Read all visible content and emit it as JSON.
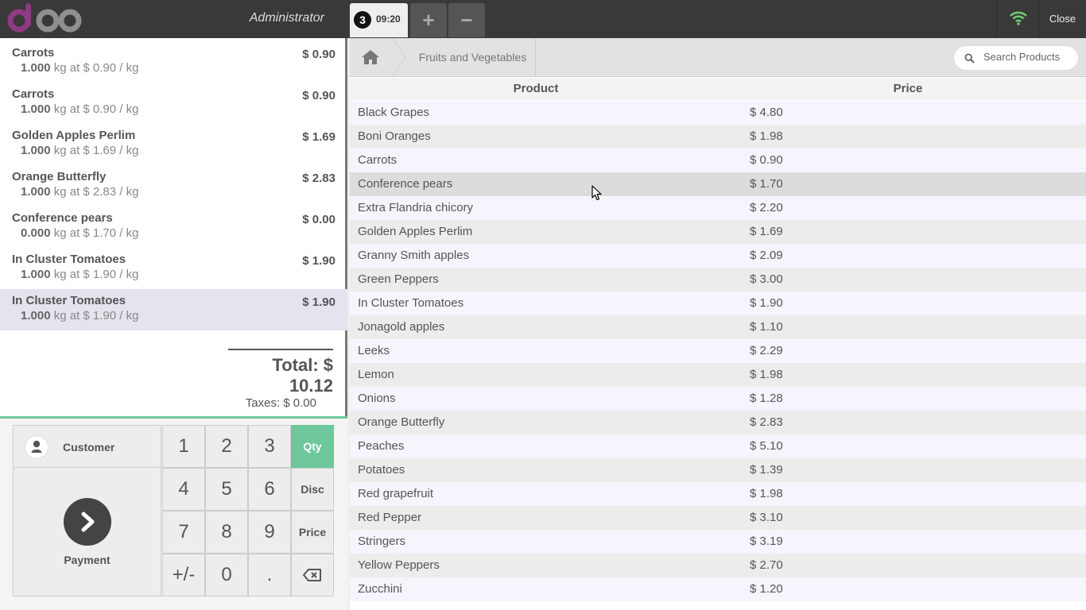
{
  "header": {
    "cashier": "Administrator",
    "order_tab": {
      "sequence": "3",
      "time": "09:20"
    },
    "add_order_label": "+",
    "remove_order_label": "−",
    "close_label": "Close",
    "wifi_status_color": "#6ec86e"
  },
  "orderlines": [
    {
      "name": "Carrots",
      "price": "$ 0.90",
      "qty": "1.000",
      "info": " kg at $ 0.90 / kg"
    },
    {
      "name": "Carrots",
      "price": "$ 0.90",
      "qty": "1.000",
      "info": " kg at $ 0.90 / kg"
    },
    {
      "name": "Golden Apples Perlim",
      "price": "$ 1.69",
      "qty": "1.000",
      "info": " kg at $ 1.69 / kg"
    },
    {
      "name": "Orange Butterfly",
      "price": "$ 2.83",
      "qty": "1.000",
      "info": " kg at $ 2.83 / kg"
    },
    {
      "name": "Conference pears",
      "price": "$ 0.00",
      "qty": "0.000",
      "info": " kg at $ 1.70 / kg"
    },
    {
      "name": "In Cluster Tomatoes",
      "price": "$ 1.90",
      "qty": "1.000",
      "info": " kg at $ 1.90 / kg"
    },
    {
      "name": "In Cluster Tomatoes",
      "price": "$ 1.90",
      "qty": "1.000",
      "info": " kg at $ 1.90 / kg"
    }
  ],
  "summary": {
    "total": "Total: $ 10.12",
    "taxes": "Taxes: $ 0.00"
  },
  "actionpad": {
    "customer_label": "Customer",
    "payment_label": "Payment"
  },
  "numpad": {
    "keys": [
      "1",
      "2",
      "3",
      "4",
      "5",
      "6",
      "7",
      "8",
      "9",
      "+/-",
      "0",
      "."
    ],
    "modes": [
      "Qty",
      "Disc",
      "Price"
    ],
    "active_mode": "Qty",
    "accent_color": "#6ec89b"
  },
  "products": {
    "breadcrumb": "Fruits and Vegetables",
    "search_placeholder": "Search Products",
    "columns": [
      "Product",
      "Price"
    ],
    "rows": [
      {
        "name": "Black Grapes",
        "price": "$ 4.80"
      },
      {
        "name": "Boni Oranges",
        "price": "$ 1.98"
      },
      {
        "name": "Carrots",
        "price": "$ 0.90"
      },
      {
        "name": "Conference pears",
        "price": "$ 1.70"
      },
      {
        "name": "Extra Flandria chicory",
        "price": "$ 2.20"
      },
      {
        "name": "Golden Apples Perlim",
        "price": "$ 1.69"
      },
      {
        "name": "Granny Smith apples",
        "price": "$ 2.09"
      },
      {
        "name": "Green Peppers",
        "price": "$ 3.00"
      },
      {
        "name": "In Cluster Tomatoes",
        "price": "$ 1.90"
      },
      {
        "name": "Jonagold apples",
        "price": "$ 1.10"
      },
      {
        "name": "Leeks",
        "price": "$ 2.29"
      },
      {
        "name": "Lemon",
        "price": "$ 1.98"
      },
      {
        "name": "Onions",
        "price": "$ 1.28"
      },
      {
        "name": "Orange Butterfly",
        "price": "$ 2.83"
      },
      {
        "name": "Peaches",
        "price": "$ 5.10"
      },
      {
        "name": "Potatoes",
        "price": "$ 1.39"
      },
      {
        "name": "Red grapefruit",
        "price": "$ 1.98"
      },
      {
        "name": "Red Pepper",
        "price": "$ 3.10"
      },
      {
        "name": "Stringers",
        "price": "$ 3.19"
      },
      {
        "name": "Yellow Peppers",
        "price": "$ 2.70"
      },
      {
        "name": "Zucchini",
        "price": "$ 1.20"
      }
    ]
  }
}
